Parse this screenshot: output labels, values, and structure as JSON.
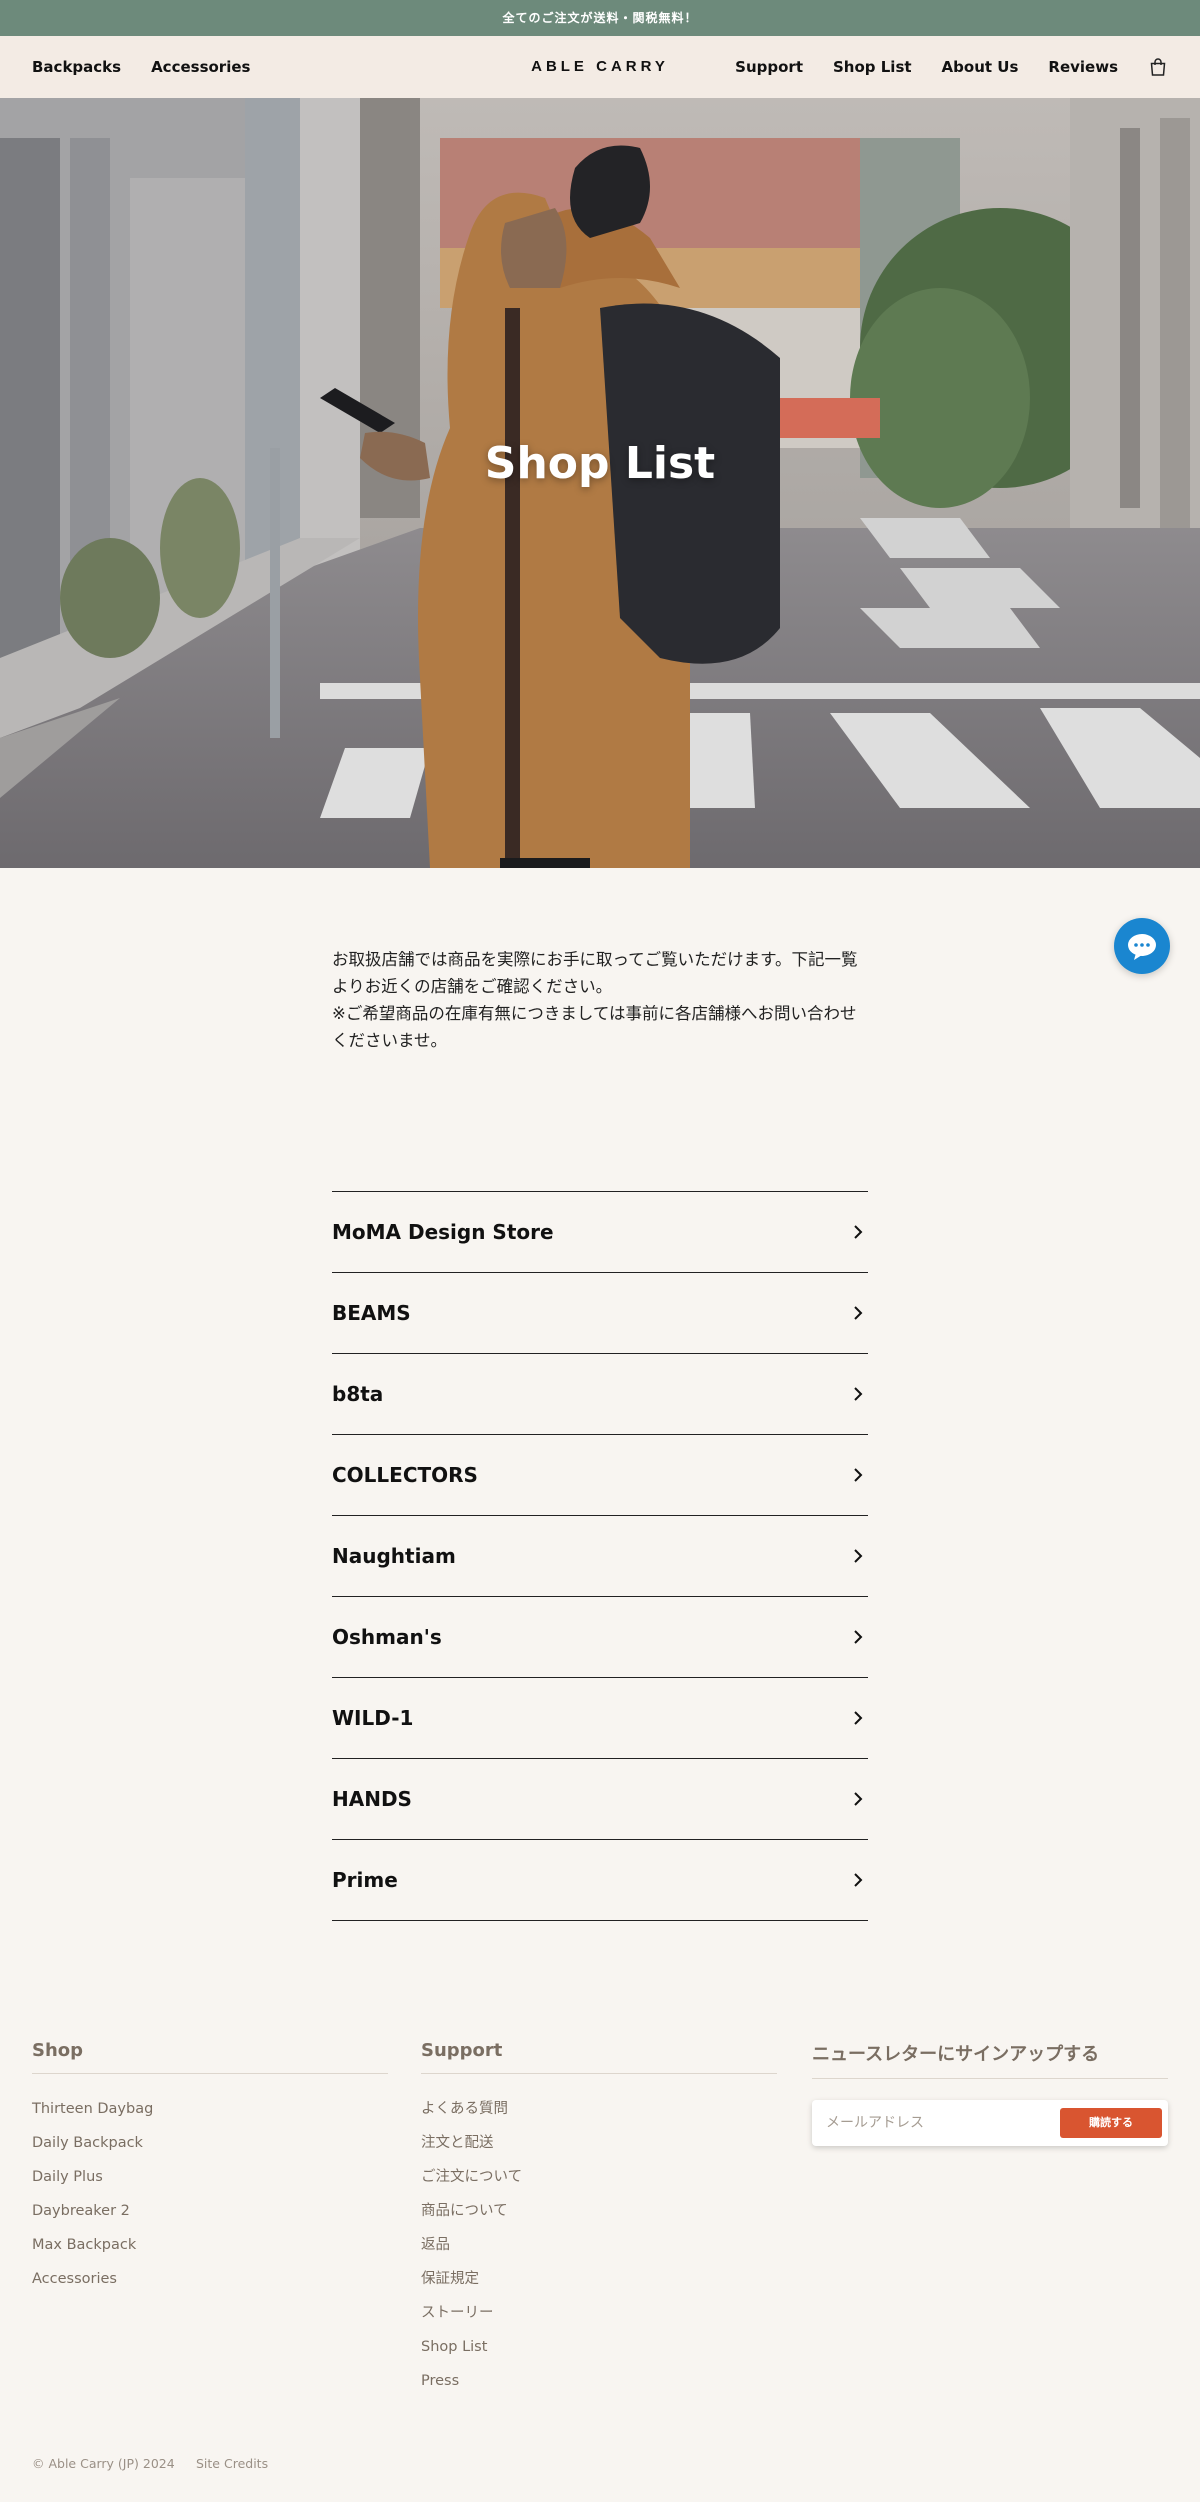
{
  "announcement": "全てのご注文が送料・関税無料！",
  "header": {
    "nav_left": [
      "Backpacks",
      "Accessories"
    ],
    "logo": "ABLE CARRY",
    "nav_right": [
      "Support",
      "Shop List",
      "About Us",
      "Reviews"
    ],
    "cart_icon": "shopping-bag-icon"
  },
  "hero": {
    "title": "Shop List"
  },
  "intro": {
    "line1": "お取扱店舗では商品を実際にお手に取ってご覧いただけます。下記一覧よりお近くの店舗をご確認ください。",
    "line2": "※ご希望商品の在庫有無につきましては事前に各店舗様へお問い合わせくださいませ。"
  },
  "shops": [
    "MoMA Design Store",
    "BEAMS",
    "b8ta",
    "COLLECTORS",
    "Naughtiam",
    "Oshman's",
    "WILD-1",
    "HANDS",
    "Prime"
  ],
  "footer": {
    "shop": {
      "heading": "Shop",
      "links": [
        "Thirteen Daybag",
        "Daily Backpack",
        "Daily Plus",
        "Daybreaker 2",
        "Max Backpack",
        "Accessories"
      ]
    },
    "support": {
      "heading": "Support",
      "links": [
        "よくある質問",
        "注文と配送",
        "ご注文について",
        "商品について",
        "返品",
        "保証規定",
        "ストーリー",
        "Shop List",
        "Press"
      ]
    },
    "newsletter": {
      "heading": "ニュースレターにサインアップする",
      "placeholder": "メールアドレス",
      "button": "購読する"
    },
    "copyright": "© Able Carry (JP) 2024",
    "credits": "Site Credits"
  },
  "colors": {
    "announcement_bg": "#6d8a7b",
    "header_bg": "#f3ebe4",
    "page_bg": "#f8f5f1",
    "chat_button": "#1a86d0",
    "subscribe_button": "#d95530"
  },
  "chat_icon": "chat-bubble-icon"
}
